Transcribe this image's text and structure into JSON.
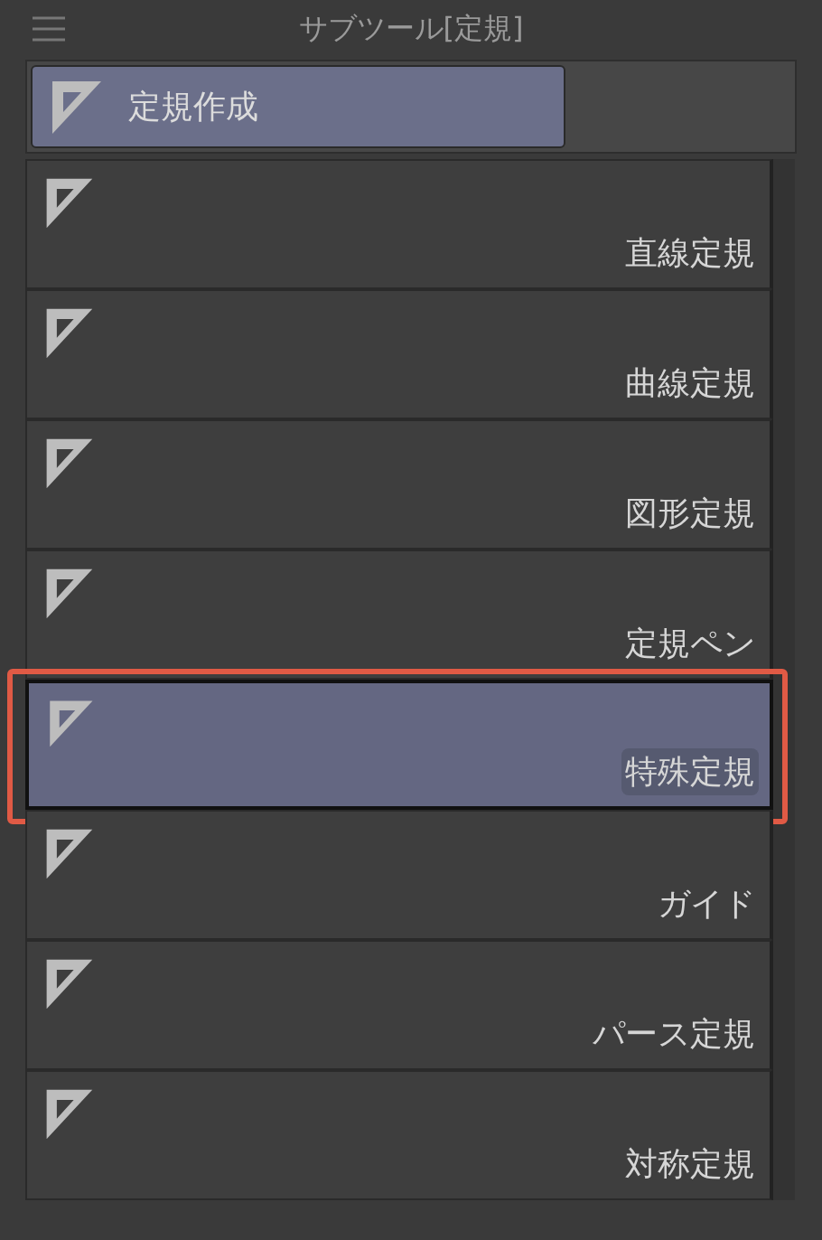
{
  "panel": {
    "title": "サブツール[定規]"
  },
  "groups": [
    {
      "label": "定規作成",
      "selected": true
    }
  ],
  "subtools": [
    {
      "label": "直線定規",
      "selected": false,
      "highlighted": false
    },
    {
      "label": "曲線定規",
      "selected": false,
      "highlighted": false
    },
    {
      "label": "図形定規",
      "selected": false,
      "highlighted": false
    },
    {
      "label": "定規ペン",
      "selected": false,
      "highlighted": false
    },
    {
      "label": "特殊定規",
      "selected": true,
      "highlighted": true
    },
    {
      "label": "ガイド",
      "selected": false,
      "highlighted": false
    },
    {
      "label": "パース定規",
      "selected": false,
      "highlighted": false
    },
    {
      "label": "対称定規",
      "selected": false,
      "highlighted": false
    }
  ]
}
